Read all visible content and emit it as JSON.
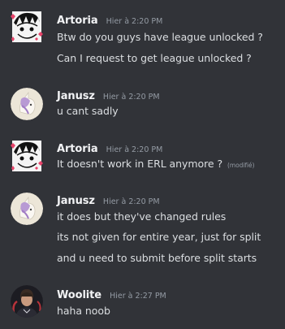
{
  "messages": [
    {
      "author": "Artoria",
      "timestamp": "Hier à 2:20 PM",
      "lines": [
        "Btw do you guys have league unlocked ?",
        "Can I request to get league unlocked ?"
      ]
    },
    {
      "author": "Janusz",
      "timestamp": "Hier à 2:20 PM",
      "lines": [
        "u cant sadly"
      ]
    },
    {
      "author": "Artoria",
      "timestamp": "Hier à 2:20 PM",
      "lines": [
        "It doesn't work in ERL anymore ?"
      ],
      "edited": "(modifié)"
    },
    {
      "author": "Janusz",
      "timestamp": "Hier à 2:20 PM",
      "lines": [
        "it does but they've changed rules",
        "its not given for entire year, just for split",
        "and u need to submit before split starts"
      ]
    },
    {
      "author": "Woolite",
      "timestamp": "Hier à 2:27 PM",
      "lines": [
        "haha noob"
      ]
    }
  ],
  "colors": {
    "background": "#313338",
    "author": "#f2f3f5",
    "text": "#dbdee1",
    "muted": "#949ba4"
  },
  "icons": {
    "artoria_avatar": "anime-sketch-avatar",
    "janusz_avatar": "unicorn-avatar",
    "woolite_avatar": "person-photo-avatar"
  }
}
